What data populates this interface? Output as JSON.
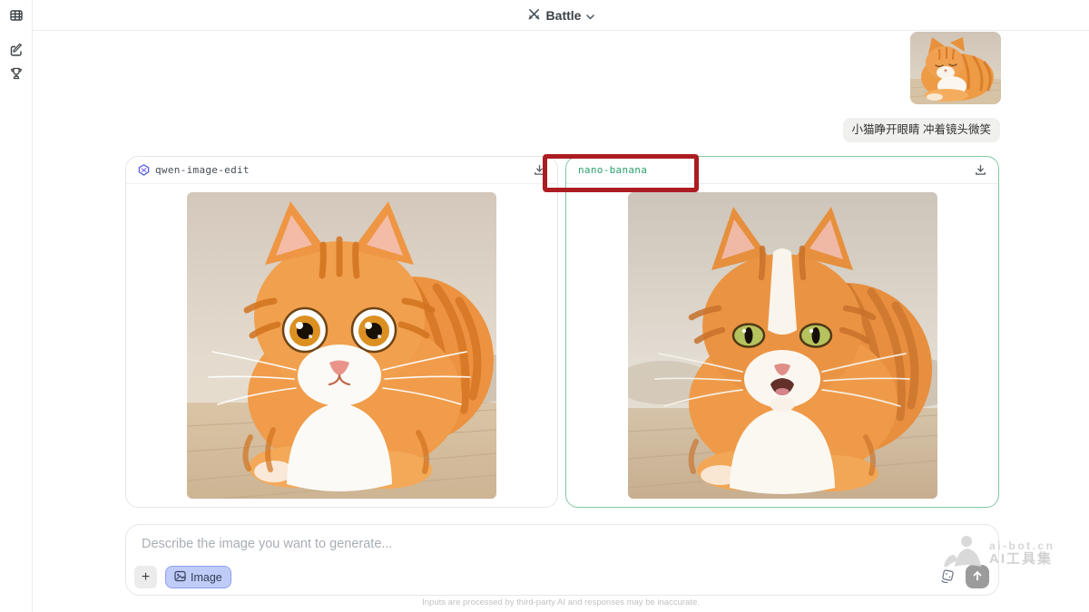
{
  "app": {
    "title_bar": {
      "label": "Battle",
      "icon": "crossed-swords-icon"
    }
  },
  "sidebar": {
    "items": [
      {
        "id": "models-grid",
        "icon": "grid-icon"
      },
      {
        "id": "new-chat",
        "icon": "compose-icon"
      },
      {
        "id": "leaderboard",
        "icon": "trophy-icon"
      }
    ]
  },
  "conversation": {
    "user_message": {
      "prompt": "小猫睁开眼睛 冲着镜头微笑",
      "attachment": "orange-cat-photo-thumbnail"
    }
  },
  "battle": {
    "panels": [
      {
        "model": "qwen-image-edit",
        "model_icon": "qwen-logo-icon",
        "download_icon": "download-icon"
      },
      {
        "model": "nano-banana",
        "download_icon": "download-icon",
        "highlighted": true
      }
    ]
  },
  "annotation": {
    "type": "highlight-rectangle",
    "color": "#ab1d22"
  },
  "composer": {
    "placeholder": "Describe the image you want to generate...",
    "add_button": "+",
    "image_button": "Image"
  },
  "watermark": {
    "line1": "ai-bot.cn",
    "line2": "AI工具集"
  },
  "footer": {
    "disclaimer": "Inputs are processed by third-party AI and responses may be inaccurate."
  },
  "colors": {
    "winner_border_green": "#82c8a3",
    "nano_banana_text": "#2ba06c",
    "annotation_red": "#ab1d22",
    "image_button_bg": "#c0ccf8",
    "image_button_border": "#8ba0f0"
  }
}
